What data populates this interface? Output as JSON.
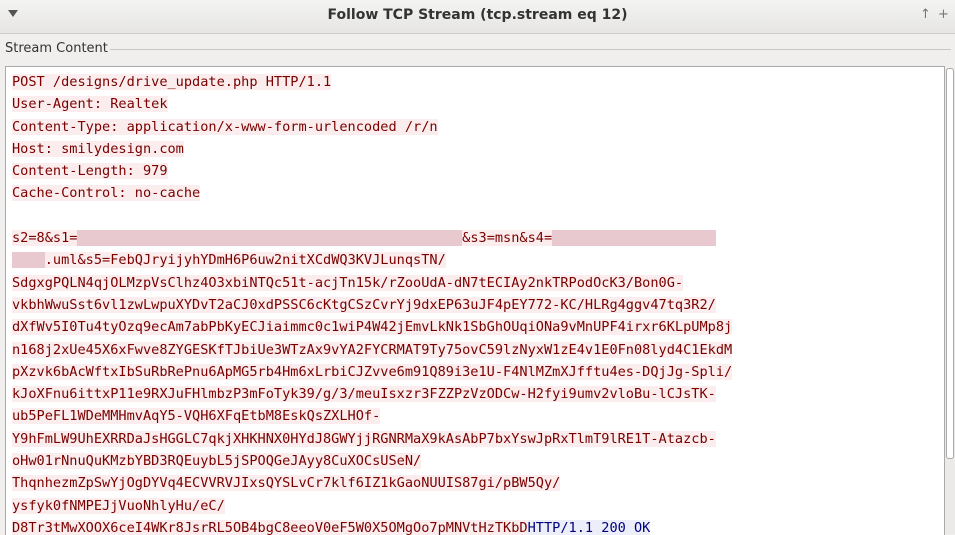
{
  "window": {
    "title": "Follow TCP Stream (tcp.stream eq 12)",
    "btn_up": "↑",
    "btn_add": "+"
  },
  "group": {
    "label": "Stream Content"
  },
  "stream": {
    "request_headers": [
      "POST /designs/drive_update.php HTTP/1.1",
      "User-Agent: Realtek",
      "Content-Type: application/x-www-form-urlencoded /r/n",
      "Host: smilydesign.com",
      "Content-Length: 979",
      "Cache-Control: no-cache"
    ],
    "body": {
      "p1": "s2=8&s1=",
      "p2": "&s3=msn&s4=",
      "p3": ".uml&s5=FebQJryijyhYDmH6P6uw2nitXCdWQ3KVJLunqsTN/",
      "lines": [
        "SdgxgPQLN4qjOLMzpVsClhz4O3xbiNTQc51t-acjTn15k/rZooUdA-dN7tECIAy2nkTRPodOcK3/Bon0G-",
        "vkbhWwuSst6vl1zwLwpuXYDvT2aCJ0xdPSSC6cKtgCSzCvrYj9dxEP63uJF4pEY772-KC/HLRg4ggv47tq3R2/",
        "dXfWv5I0Tu4tyOzq9ecAm7abPbKyECJiaimmc0c1wiP4W42jEmvLkNk1SbGhOUqiONa9vMnUPF4irxr6KLpUMp8j",
        "n168j2xUe45X6xFwve8ZYGESKfTJbiUe3WTzAx9vYA2FYCRMAT9Ty75ovC59lzNyxW1zE4v1E0Fn08lyd4C1EkdM",
        "pXzvk6bAcWftxIbSuRbRePnu6ApMG5rb4Hm6xLrbiCJZvve6m91Q89i3e1U-F4NlMZmXJfftu4es-DQjJg-Spli/",
        "kJoXFnu6ittxP11e9RXJuFHlmbzP3mFoTyk39/g/3/meuIsxzr3FZZPzVzODCw-H2fyi9umv2vloBu-lCJsTK-",
        "ub5PeFL1WDeMMHmvAqY5-VQH6XFqEtbM8EskQsZXLHOf-",
        "Y9hFmLW9UhEXRRDaJsHGGLC7qkjXHKHNX0HYdJ8GWYjjRGNRMaX9kAsAbP7bxYswJpRxTlmT9lRE1T-Atazcb-",
        "oHw01rNnuQuKMzbYBD3RQEuybL5jSPOQGeJAyy8CuXOCsUSeN/",
        "ThqnhezmZpSwYjOgDYVq4ECVVRVJIxsQYSLvCr7klf6IZ1kGaoNUUIS87gi/pBW5Qy/",
        "ysfyk0fNMPEJjVuoNhlyHu/eC/"
      ],
      "last": "D8Tr3tMwXOOX6ceI4WKr8JsrRL5OB4bgC8eeoV0eF5W0X5OMgOo7pMNVtHzTKbD"
    },
    "response": "HTTP/1.1 200 OK"
  }
}
